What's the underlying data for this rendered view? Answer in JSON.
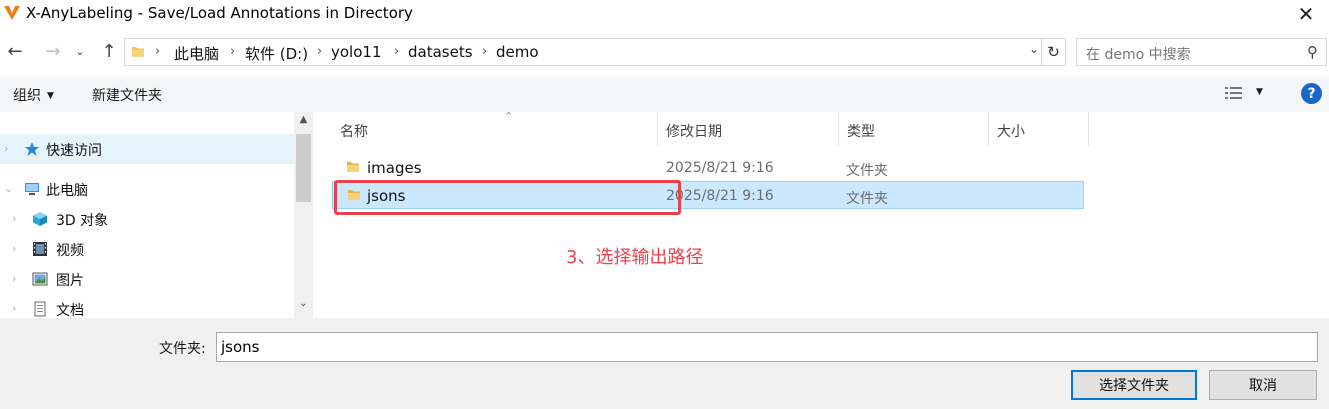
{
  "window": {
    "title": "X-AnyLabeling - Save/Load Annotations in Directory",
    "close_glyph": "✕"
  },
  "nav": {
    "breadcrumbs": [
      "此电脑",
      "软件 (D:)",
      "yolo11",
      "datasets",
      "demo"
    ],
    "search_placeholder": "在 demo 中搜索"
  },
  "toolbar": {
    "organize_label": "组织",
    "new_folder_label": "新建文件夹",
    "help_label": "?"
  },
  "navpane": {
    "items": [
      {
        "label": "快速访问",
        "icon": "star-icon"
      },
      {
        "label": "此电脑",
        "icon": "computer-icon"
      },
      {
        "label": "3D 对象",
        "icon": "cube-icon"
      },
      {
        "label": "视频",
        "icon": "film-icon"
      },
      {
        "label": "图片",
        "icon": "picture-icon"
      },
      {
        "label": "文档",
        "icon": "document-icon"
      }
    ]
  },
  "filelist": {
    "columns": [
      "名称",
      "修改日期",
      "类型",
      "大小"
    ],
    "rows": [
      {
        "name": "images",
        "modified": "2025/8/21 9:16",
        "type": "文件夹",
        "size": "",
        "selected": false
      },
      {
        "name": "jsons",
        "modified": "2025/8/21 9:16",
        "type": "文件夹",
        "size": "",
        "selected": true
      }
    ]
  },
  "annotation": {
    "text": "3、选择输出路径",
    "color": "#e8424c"
  },
  "bottom": {
    "folder_label": "文件夹:",
    "folder_value": "jsons",
    "select_button": "选择文件夹",
    "cancel_button": "取消"
  },
  "colors": {
    "accent": "#0078d7",
    "selection": "#cce8ff",
    "folder": "#f2c55c",
    "help": "#1b67c9"
  }
}
